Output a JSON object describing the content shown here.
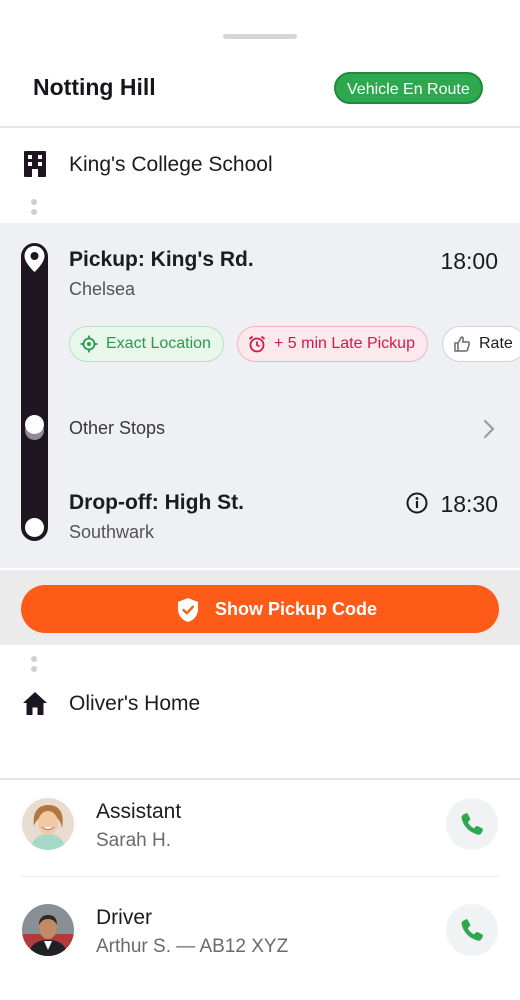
{
  "header": {
    "route_name": "Notting Hill",
    "status": "Vehicle En Route"
  },
  "origin": {
    "label": "King's College School",
    "icon": "building-icon"
  },
  "trip": {
    "pickup": {
      "title": "Pickup: King's Rd.",
      "area": "Chelsea",
      "time": "18:00"
    },
    "chips": [
      {
        "label": "Exact Location",
        "icon": "location-target-icon",
        "color": "#2a9a4b"
      },
      {
        "label": "+ 5 min Late Pickup",
        "icon": "alarm-icon",
        "color": "#d3184f"
      },
      {
        "label": "Rate",
        "icon": "thumbs-up-icon"
      }
    ],
    "other_stops": "Other Stops",
    "dropoff": {
      "title": "Drop-off: High St.",
      "area": "Southwark",
      "time": "18:30"
    }
  },
  "cta": {
    "label": "Show Pickup Code",
    "color": "#fd5b17"
  },
  "destination": {
    "label": "Oliver's Home",
    "icon": "home-icon"
  },
  "contacts": [
    {
      "role": "Assistant",
      "name": "Sarah H."
    },
    {
      "role": "Driver",
      "name": "Arthur S. — AB12 XYZ"
    }
  ],
  "colors": {
    "status_green": "#2ea84f",
    "panel_bg": "#eef0f3",
    "call_green": "#2ea84f"
  }
}
